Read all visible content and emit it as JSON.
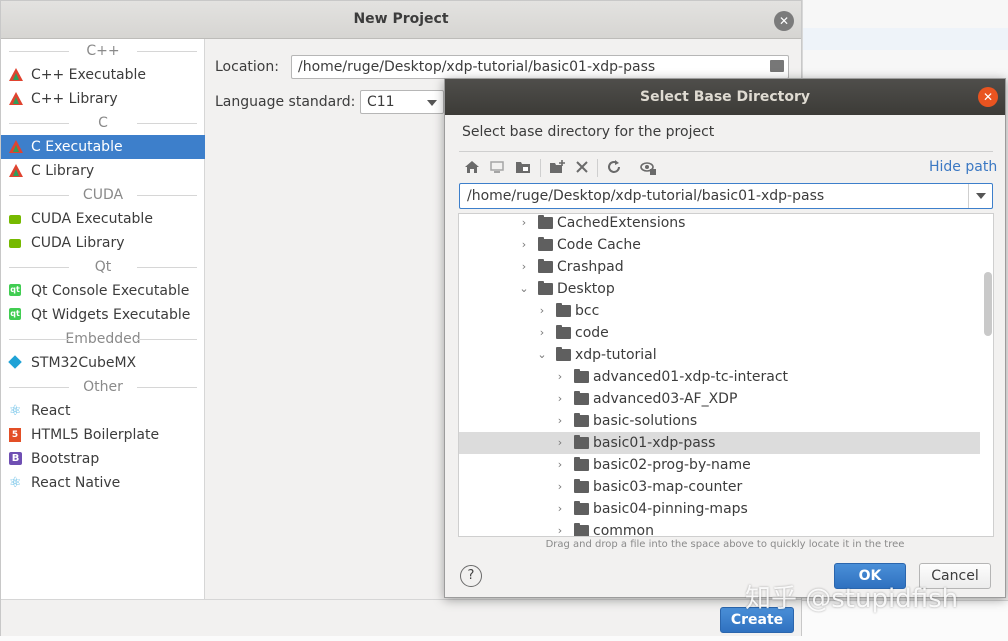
{
  "new_project": {
    "title": "New Project",
    "groups": {
      "cpp": "C++",
      "c": "C",
      "cuda": "CUDA",
      "qt": "Qt",
      "embedded": "Embedded",
      "other": "Other"
    },
    "items": {
      "cpp_exe": "C++ Executable",
      "cpp_lib": "C++ Library",
      "c_exe": "C Executable",
      "c_lib": "C Library",
      "cuda_exe": "CUDA Executable",
      "cuda_lib": "CUDA Library",
      "qt_console": "Qt Console Executable",
      "qt_widgets": "Qt Widgets Executable",
      "stm32": "STM32CubeMX",
      "react": "React",
      "html5": "HTML5 Boilerplate",
      "bootstrap": "Bootstrap",
      "react_native": "React Native"
    },
    "selected_item": "C Executable",
    "location_label": "Location:",
    "location_value": "/home/ruge/Desktop/xdp-tutorial/basic01-xdp-pass",
    "lang_label": "Language standard:",
    "lang_value": "C11",
    "create_label": "Create"
  },
  "dialog": {
    "title": "Select Base Directory",
    "subtitle": "Select base directory for the project",
    "hide_path": "Hide path",
    "path": "/home/ruge/Desktop/xdp-tutorial/basic01-xdp-pass",
    "tree": {
      "cached": "CachedExtensions",
      "code_cache": "Code Cache",
      "crashpad": "Crashpad",
      "desktop": "Desktop",
      "bcc": "bcc",
      "code": "code",
      "xdp": "xdp-tutorial",
      "adv01": "advanced01-xdp-tc-interact",
      "adv03": "advanced03-AF_XDP",
      "sol": "basic-solutions",
      "b01": "basic01-xdp-pass",
      "b02": "basic02-prog-by-name",
      "b03": "basic03-map-counter",
      "b04": "basic04-pinning-maps",
      "common": "common"
    },
    "hint": "Drag and drop a file into the space above to quickly locate it in the tree",
    "help": "?",
    "ok_label": "OK",
    "cancel_label": "Cancel"
  },
  "background": {
    "code_fragment": "          "
  },
  "watermark": "知乎 @stupidfish",
  "colors": {
    "selection": "#3d7fcb",
    "dialog_title": "#3c3b37",
    "close_orange": "#e95420",
    "link": "#3b78c3"
  }
}
